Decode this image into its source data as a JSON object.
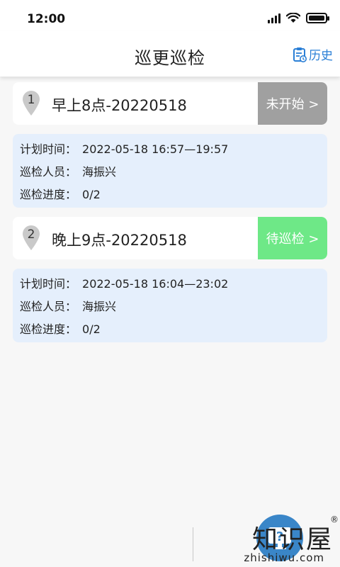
{
  "status_bar": {
    "time": "12:00"
  },
  "nav": {
    "title": "巡更巡检",
    "history_label": "历史"
  },
  "routes": [
    {
      "index": "1",
      "name": "早上8点-20220518",
      "status": "未开始 >",
      "details": [
        {
          "label": "计划时间：",
          "value": "2022-05-18 16:57—19:57"
        },
        {
          "label": "巡检人员：",
          "value": "海振兴"
        },
        {
          "label": "巡检进度：",
          "value": "0/2"
        }
      ]
    },
    {
      "index": "2",
      "name": "晚上9点-20220518",
      "status": "待巡检 >",
      "details": [
        {
          "label": "计划时间：",
          "value": "2022-05-18 16:04—23:02"
        },
        {
          "label": "巡检人员：",
          "value": "海振兴"
        },
        {
          "label": "巡检进度：",
          "value": "0/2"
        }
      ]
    }
  ],
  "watermark": {
    "brand": "知识屋",
    "domain": "zhishiwu.com",
    "reg_mark": "®"
  },
  "colors": {
    "accent": "#2a7fd6",
    "status_not_started": "#a0a0a0",
    "status_pending": "#6ee887",
    "detail_bg": "#e5effc"
  },
  "icons": [
    "signal-icon",
    "wifi-icon",
    "battery-icon",
    "history-clipboard-icon",
    "location-pin-icon",
    "help-monitor-icon"
  ]
}
